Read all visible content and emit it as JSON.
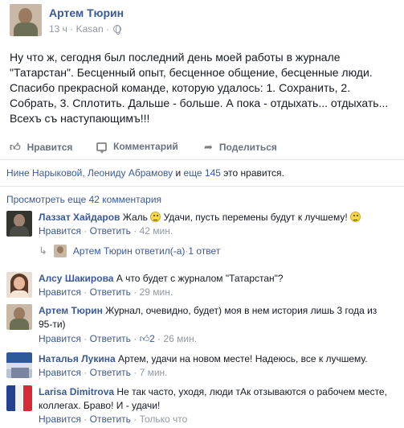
{
  "post": {
    "author": "Артем Тюрин",
    "time": "13 ч",
    "location": "Kasan",
    "text": "Ну что ж, сегодня был последний день моей работы в журнале \"Татарстан\". Бесценный опыт, бесценное общение, бесценные люди. Спасибо прекрасной команде, которую удалось: 1. Сохранить, 2. Собрать, 3. Сплотить. Дальше - больше. А пока - отдыхать... отдыхать... Всехъ съ наступающимъ!!!"
  },
  "actions": {
    "like": "Нравится",
    "comment": "Комментарий",
    "share": "Поделиться"
  },
  "likes": {
    "names": "Нине Нарыковой, Леониду Абрамову",
    "and": " и ",
    "more": "еще 145",
    "tail": " это нравится."
  },
  "view_more": "Просмотреть еще 42 комментария",
  "comments": [
    {
      "author": "Лаззат Хайдаров",
      "text_a": "Жаль ",
      "text_b": " Удачи, пусть перемены будут к лучшему! ",
      "like": "Нравится",
      "reply": "Ответить",
      "time": "42 мин."
    },
    {
      "author": "Алсу Шакирова",
      "text": "А что будет с журналом \"Татарстан\"?",
      "like": "Нравится",
      "reply": "Ответить",
      "time": "29 мин."
    },
    {
      "author": "Артем Тюрин",
      "text": "Журнал, очевидно, будет) моя в нем история лишь 3 года из 95-ти)",
      "like": "Нравится",
      "reply": "Ответить",
      "likes_count": "2",
      "time": "26 мин."
    },
    {
      "author": "Наталья Лукина",
      "text": "Артем, удачи на новом месте! Надеюсь, все к лучшему.",
      "like": "Нравится",
      "reply": "Ответить",
      "time": "7 мин."
    },
    {
      "author": "Larisa Dimitrova",
      "text": "Не так часто, уходя, люди тАк отзываются о рабочем месте, коллегах. Браво! И - удачи!",
      "like": "Нравится",
      "reply": "Ответить",
      "time": "Только что"
    }
  ],
  "reply_row": {
    "author": "Артем Тюрин",
    "replied": "ответил(-а)",
    "count": "1 ответ"
  },
  "separator": " · ",
  "icons": [
    "globe-icon",
    "thumbs-up-icon",
    "comment-icon",
    "share-icon",
    "reply-arrow-icon",
    "smiley-icon"
  ],
  "colors": {
    "link": "#3b5998",
    "muted": "#9197a3",
    "text": "#141823"
  }
}
